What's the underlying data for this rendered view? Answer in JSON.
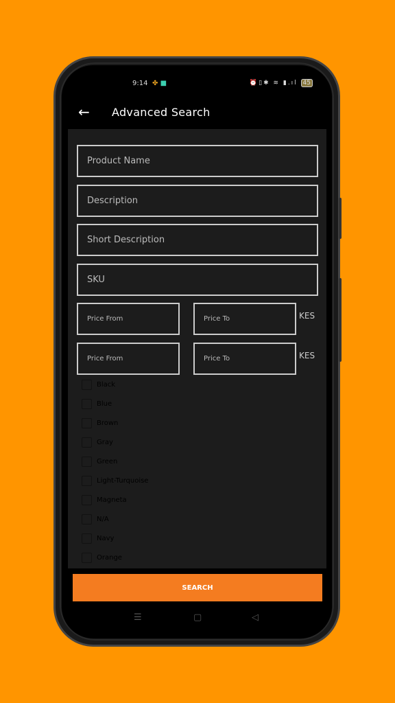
{
  "status": {
    "time": "9:14",
    "battery": "45"
  },
  "header": {
    "title": "Advanced Search"
  },
  "fields": {
    "product_name": "Product Name",
    "description": "Description",
    "short_description": "Short Description",
    "sku": "SKU"
  },
  "price_rows": [
    {
      "from": "Price From",
      "to": "Price To",
      "currency": "KES"
    },
    {
      "from": "Price From",
      "to": "Price To",
      "currency": "KES"
    }
  ],
  "colors": [
    "Black",
    "Blue",
    "Brown",
    "Gray",
    "Green",
    "Light-Turquoise",
    "Magneta",
    "N/A",
    "Navy",
    "Orange"
  ],
  "search_label": "SEARCH",
  "theme": {
    "accent": "#f47c20",
    "background": "#ff9500"
  }
}
